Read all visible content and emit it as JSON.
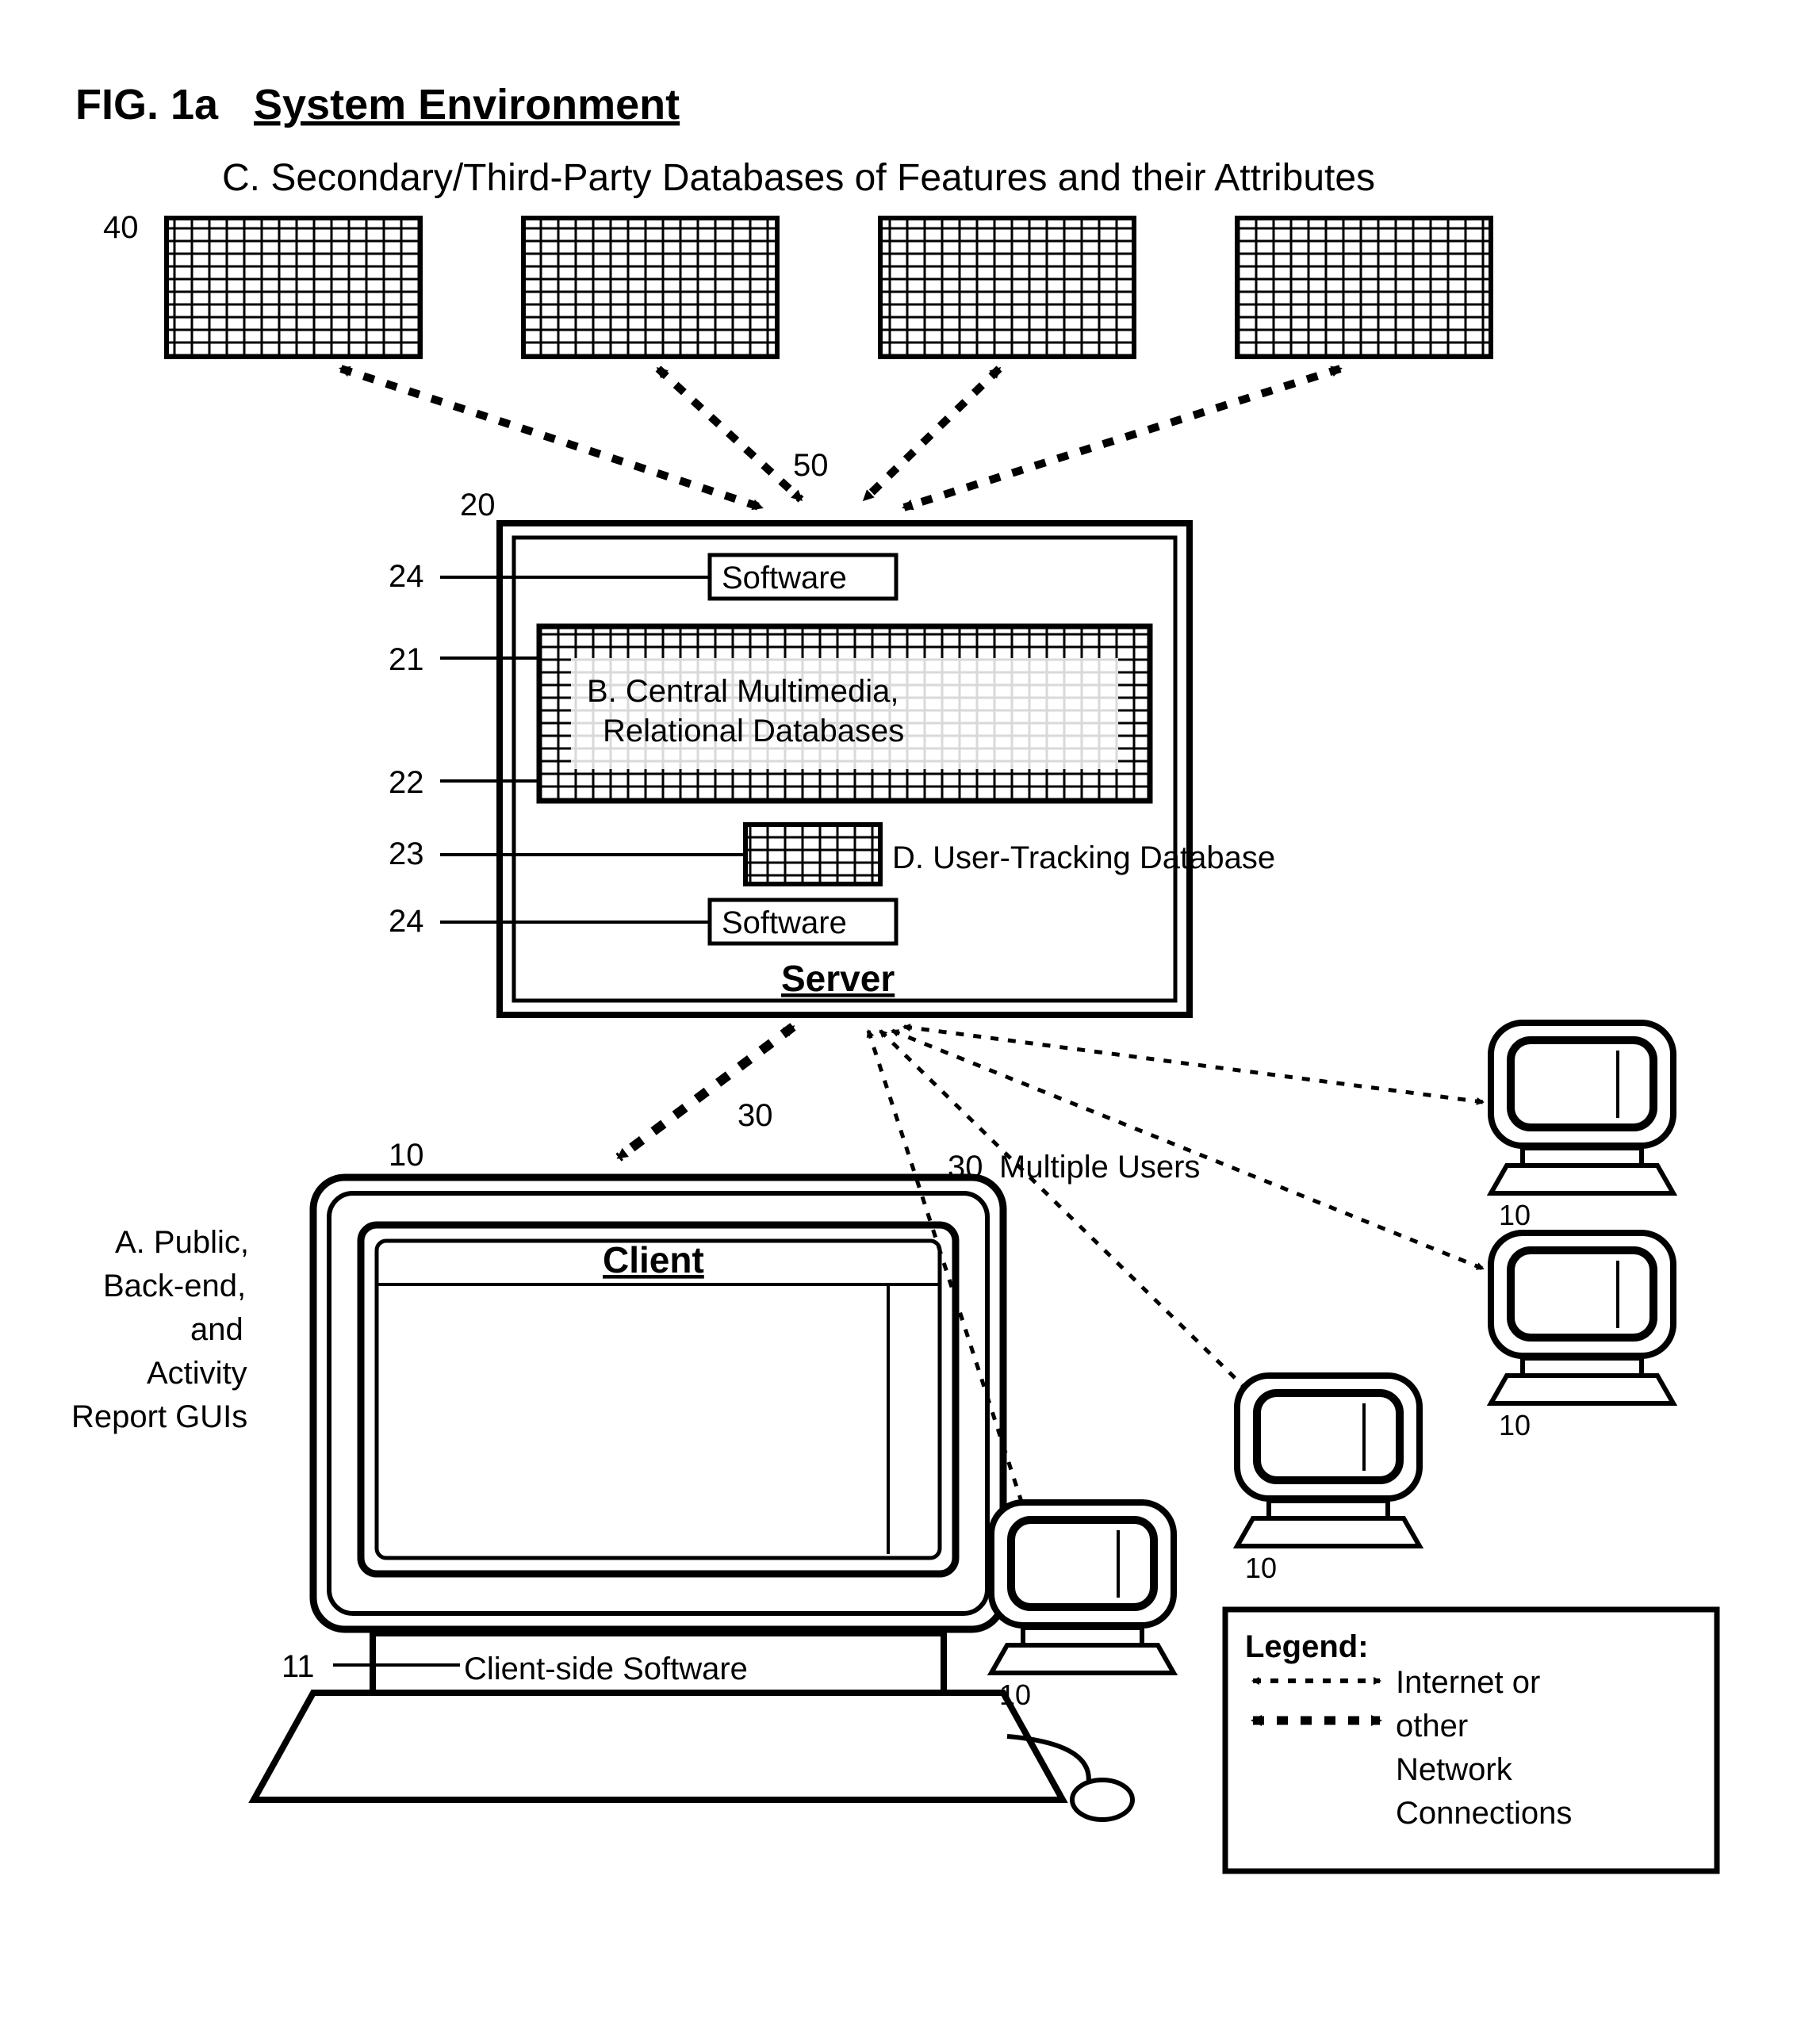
{
  "figure_id": "FIG. 1a",
  "figure_title": "System Environment",
  "sections": {
    "A": "A. Public, Back-end, and Activity Report GUIs",
    "B": "B. Central Multimedia, Relational Databases",
    "C": "C. Secondary/Third-Party Databases of Features and their Attributes",
    "D": "D. User-Tracking Database"
  },
  "server": {
    "title": "Server",
    "software_label": "Software"
  },
  "client": {
    "title": "Client",
    "software_label": "Client-side Software"
  },
  "multiple_users": "Multiple Users",
  "legend": {
    "title": "Legend:",
    "text": "Internet or other Network Connections"
  },
  "refs": {
    "client": "10",
    "client_sw": "11",
    "server": "20",
    "central_db_top": "21",
    "central_db_bottom": "22",
    "tracking_db": "23",
    "software": "24",
    "client_conn": "30",
    "thirdparty_db": "40",
    "thirdparty_conn": "50"
  }
}
